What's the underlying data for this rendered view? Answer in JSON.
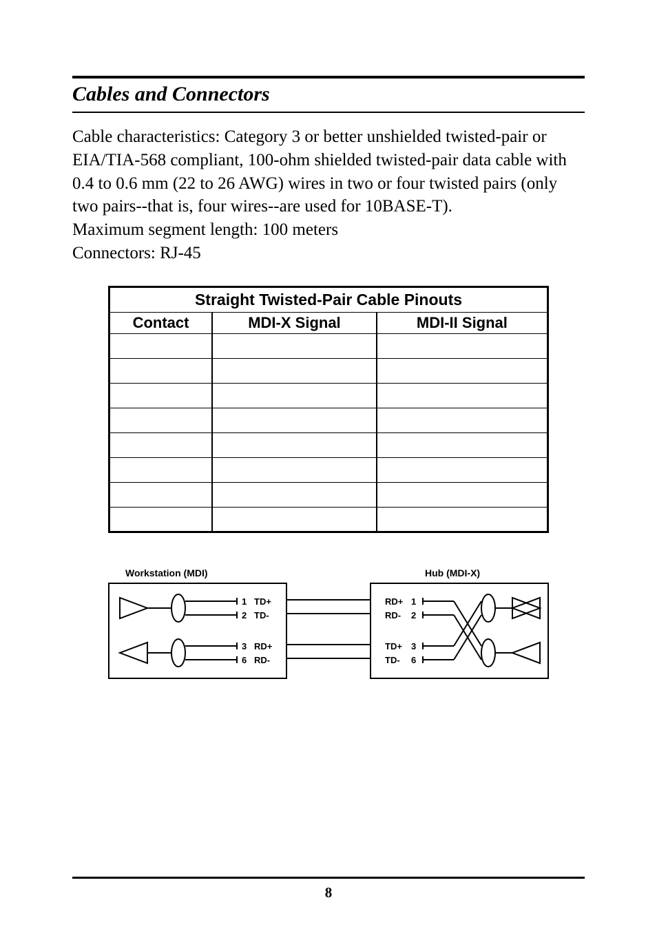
{
  "section_title": "Cables and Connectors",
  "body": {
    "para1": "Cable characteristics: Category 3 or better unshielded twisted-pair or EIA/TIA-568 compliant, 100-ohm shielded twisted-pair data cable with 0.4 to 0.6 mm (22 to 26 AWG) wires in two or four twisted pairs (only two pairs--that is, four wires--are used for 10BASE-T).",
    "para2": "Maximum segment length:   100 meters",
    "para3": "Connectors:    RJ-45"
  },
  "table": {
    "title": "Straight Twisted-Pair Cable Pinouts",
    "headers": {
      "contact": "Contact",
      "mdix": "MDI-X Signal",
      "mdiii": "MDI-II Signal"
    },
    "rows": [
      {
        "contact": "",
        "mdix": "",
        "mdiii": ""
      },
      {
        "contact": "",
        "mdix": "",
        "mdiii": ""
      },
      {
        "contact": "",
        "mdix": "",
        "mdiii": ""
      },
      {
        "contact": "",
        "mdix": "",
        "mdiii": ""
      },
      {
        "contact": "",
        "mdix": "",
        "mdiii": ""
      },
      {
        "contact": "",
        "mdix": "",
        "mdiii": ""
      },
      {
        "contact": "",
        "mdix": "",
        "mdiii": ""
      },
      {
        "contact": "",
        "mdix": "",
        "mdiii": ""
      }
    ]
  },
  "diagram": {
    "left_title": "Workstation (MDI)",
    "right_title": "Hub (MDI-X)",
    "left_pins": [
      {
        "num": "1",
        "sig": "TD+"
      },
      {
        "num": "2",
        "sig": "TD-"
      },
      {
        "num": "3",
        "sig": "RD+"
      },
      {
        "num": "6",
        "sig": "RD-"
      }
    ],
    "right_pins": [
      {
        "sig": "RD+",
        "num": "1"
      },
      {
        "sig": "RD-",
        "num": "2"
      },
      {
        "sig": "TD+",
        "num": "3"
      },
      {
        "sig": "TD-",
        "num": "6"
      }
    ]
  },
  "page_number": "8"
}
